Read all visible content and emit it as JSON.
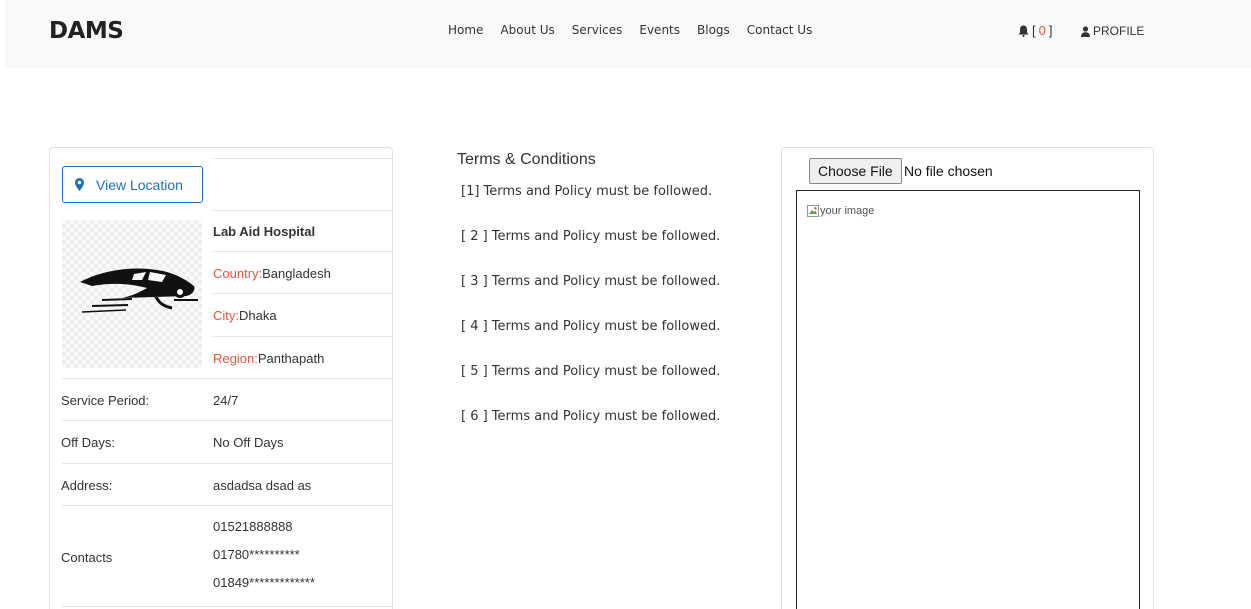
{
  "header": {
    "logo": "DAMS",
    "nav": [
      "Home",
      "About Us",
      "Services",
      "Events",
      "Blogs",
      "Contact Us"
    ],
    "notif_open": "[",
    "notif_count": "0",
    "notif_close": "]",
    "profile": "PROFILE"
  },
  "hospital": {
    "view_location": "View Location",
    "name": "Lab Aid Hospital",
    "country_label": "Country:",
    "country": "Bangladesh",
    "city_label": "City:",
    "city": "Dhaka",
    "region_label": "Region:",
    "region": "Panthapath",
    "service_period_label": "Service Period:",
    "service_period": "24/7",
    "off_days_label": "Off Days:",
    "off_days": "No Off Days",
    "address_label": "Address:",
    "address": "asdadsa dsad as",
    "contacts_label": "Contacts",
    "contacts": [
      "01521888888",
      "01780**********",
      "01849*************"
    ]
  },
  "terms": {
    "title": "Terms & Conditions",
    "items": [
      "[1] Terms and Policy must be followed.",
      "[ 2 ] Terms and Policy must be followed.",
      "[ 3 ] Terms and Policy must be followed.",
      "[ 4 ] Terms and Policy must be followed.",
      "[ 5 ] Terms and Policy must be followed.",
      "[ 6 ] Terms and Policy must be followed."
    ]
  },
  "upload": {
    "button": "Choose File",
    "status": "No file chosen",
    "image_alt": "your image"
  },
  "colors": {
    "accent": "#e0583f",
    "link": "#1f6fbf"
  }
}
